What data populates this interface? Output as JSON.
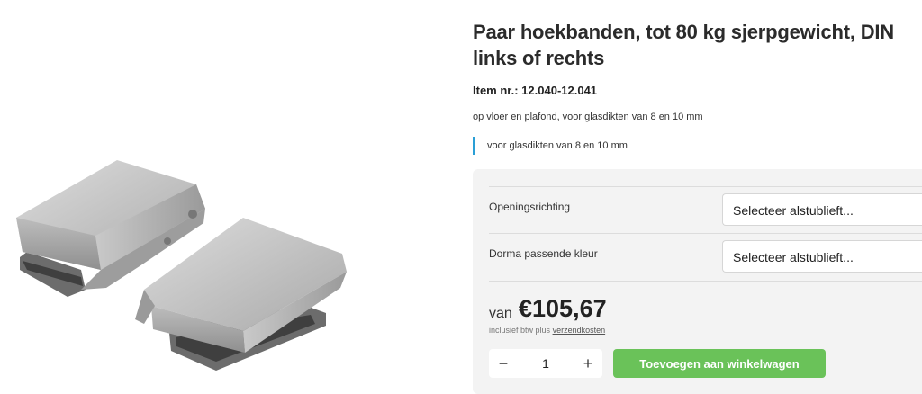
{
  "product": {
    "title": "Paar hoekbanden, tot 80 kg sjerpgewicht, DIN links of rechts",
    "item_number": "Item nr.: 12.040-12.041",
    "description": "op vloer en plafond, voor glasdikten van 8 en 10 mm",
    "feature": "voor glasdikten van 8 en 10 mm"
  },
  "options": [
    {
      "label": "Openingsrichting",
      "value": "Selecteer alstublieft..."
    },
    {
      "label": "Dorma passende kleur",
      "value": "Selecteer alstublieft..."
    }
  ],
  "pricing": {
    "prefix": "van",
    "price": "€105,67",
    "tax_text": "inclusief btw plus",
    "shipping_link": "verzendkosten"
  },
  "cart": {
    "minus": "−",
    "quantity": "1",
    "plus": "+",
    "add_label": "Toevoegen aan winkelwagen"
  },
  "colors": {
    "accent_blue": "#2a9fd6",
    "add_button_green": "#6ac259",
    "panel_bg": "#f3f3f3"
  }
}
